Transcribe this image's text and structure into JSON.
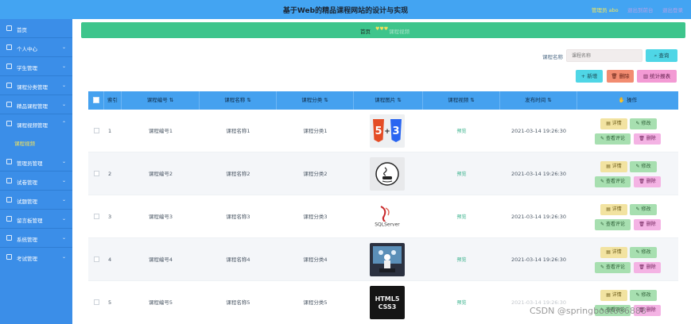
{
  "header": {
    "title": "基于Web的精品课程网站的设计与实现",
    "user": "管理员 abo",
    "link_front": "退出到前台",
    "link_logout": "退出登录"
  },
  "sidebar": {
    "items": [
      {
        "label": "首页"
      },
      {
        "label": "个人中心"
      },
      {
        "label": "学生管理"
      },
      {
        "label": "课程分类管理"
      },
      {
        "label": "精品课程管理"
      },
      {
        "label": "课程视频管理"
      },
      {
        "label": "管理员管理"
      },
      {
        "label": "试卷管理"
      },
      {
        "label": "试题管理"
      },
      {
        "label": "留言板管理"
      },
      {
        "label": "系统管理"
      },
      {
        "label": "考试管理"
      }
    ],
    "submenu_active": "课程视频"
  },
  "breadcrumb": {
    "home": "首页",
    "separator": "♥♥♥",
    "current": "课程视频"
  },
  "search": {
    "label": "课程名称",
    "placeholder": "课程名称",
    "button": "查询"
  },
  "toolbar": {
    "add": "+ 新增",
    "delete": "删除",
    "stats": "统计报表"
  },
  "table": {
    "columns": [
      "",
      "索引",
      "课程编号",
      "课程名称",
      "课程分类",
      "课程图片",
      "课程视频",
      "发布时间",
      "操作"
    ],
    "rows": [
      {
        "index": "1",
        "code": "课程编号1",
        "name": "课程名称1",
        "category": "课程分类1",
        "video": "预览",
        "time": "2021-03-14 19:26:30",
        "image": "html5-css3"
      },
      {
        "index": "2",
        "code": "课程编号2",
        "name": "课程名称2",
        "category": "课程分类2",
        "video": "预览",
        "time": "2021-03-14 19:26:30",
        "image": "java-logo"
      },
      {
        "index": "3",
        "code": "课程编号3",
        "name": "课程名称3",
        "category": "课程分类3",
        "video": "预览",
        "time": "2021-03-14 19:26:30",
        "image": "sqlserver-logo"
      },
      {
        "index": "4",
        "code": "课程编号4",
        "name": "课程名称4",
        "category": "课程分类4",
        "video": "预览",
        "time": "2021-03-14 19:26:30",
        "image": "laptop-presentation"
      },
      {
        "index": "5",
        "code": "课程编号5",
        "name": "课程名称5",
        "category": "课程分类5",
        "video": "预览",
        "time": "2021-03-14 19:26:30",
        "image": "html5-css3-book"
      }
    ],
    "actions": {
      "detail": "详情",
      "edit": "修改",
      "comment": "查看评论",
      "delete": "删除"
    }
  },
  "watermark": "CSDN @springboot666888",
  "colors": {
    "topbar": "#43a4f2",
    "sidebar": "#3b8ee8",
    "breadcrumb": "#3ec58c",
    "table_header": "#45a1ef"
  }
}
